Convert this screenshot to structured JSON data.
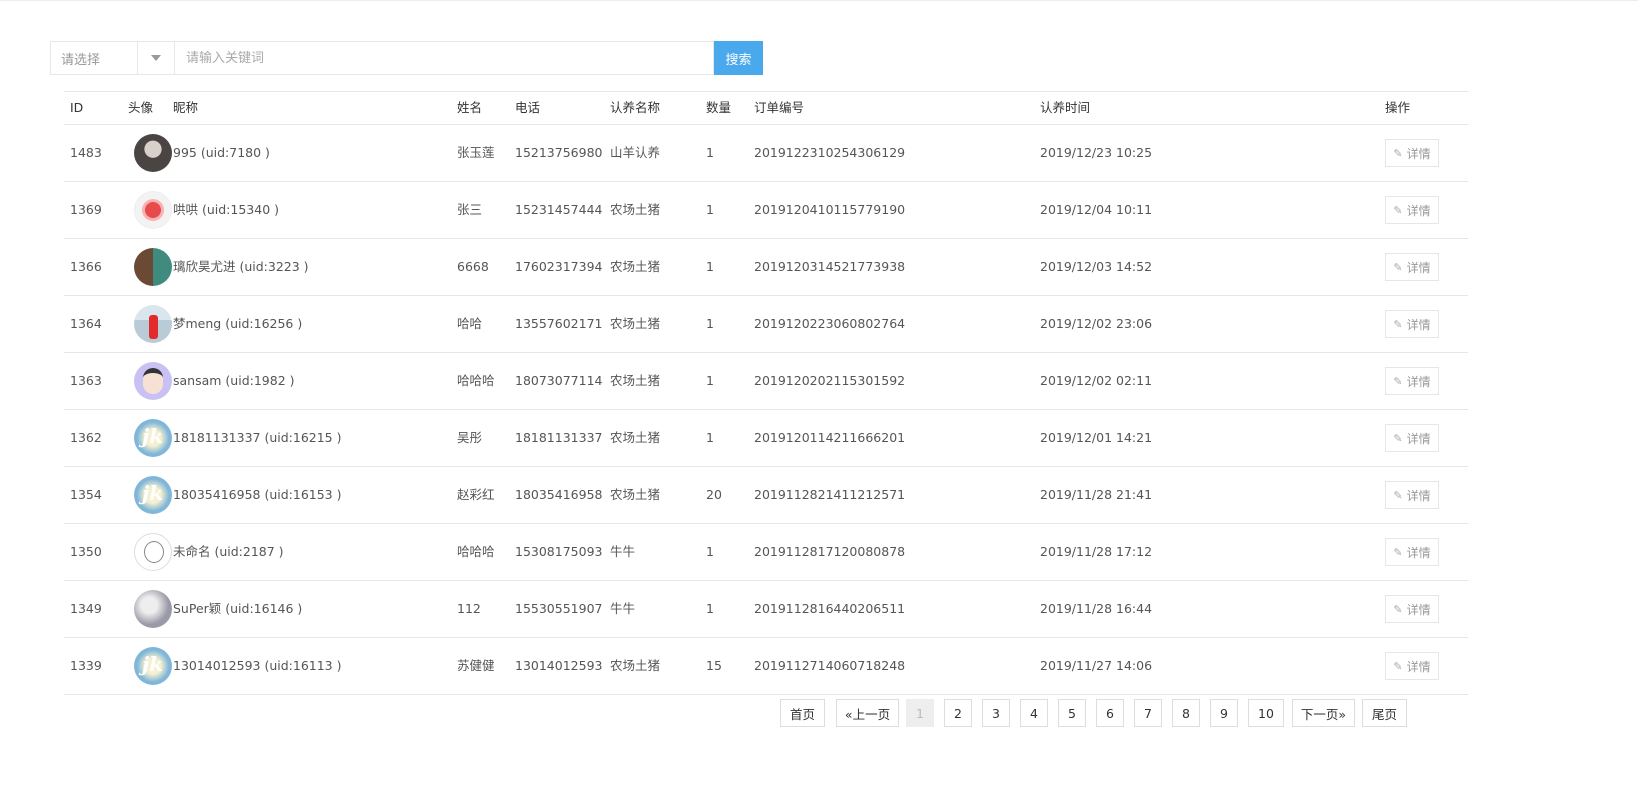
{
  "search": {
    "select_placeholder": "请选择",
    "input_placeholder": "请输入关键词",
    "button_label": "搜索"
  },
  "table": {
    "headers": {
      "id": "ID",
      "avatar": "头像",
      "nickname": "昵称",
      "name": "姓名",
      "phone": "电话",
      "adopt_name": "认养名称",
      "qty": "数量",
      "order_no": "订单编号",
      "adopt_time": "认养时间",
      "actions": "操作"
    },
    "detail_label": "详情",
    "rows": [
      {
        "id": "1483",
        "avatar": "dark",
        "nickname": "995 (uid:7180 )",
        "name": "张玉莲",
        "phone": "15213756980",
        "adopt_name": "山羊认养",
        "qty": "1",
        "order_no": "2019122310254306129",
        "adopt_time": "2019/12/23 10:25"
      },
      {
        "id": "1369",
        "avatar": "red",
        "nickname": "哄哄 (uid:15340 )",
        "name": "张三",
        "phone": "15231457444",
        "adopt_name": "农场土猪",
        "qty": "1",
        "order_no": "2019120410115779190",
        "adopt_time": "2019/12/04 10:11"
      },
      {
        "id": "1366",
        "avatar": "face",
        "nickname": "璃欣昊尤进 (uid:3223 )",
        "name": "6668",
        "phone": "17602317394",
        "adopt_name": "农场土猪",
        "qty": "1",
        "order_no": "2019120314521773938",
        "adopt_time": "2019/12/03 14:52"
      },
      {
        "id": "1364",
        "avatar": "girl",
        "nickname": "梦meng (uid:16256 )",
        "name": "哈哈",
        "phone": "13557602171",
        "adopt_name": "农场土猪",
        "qty": "1",
        "order_no": "2019120223060802764",
        "adopt_time": "2019/12/02 23:06"
      },
      {
        "id": "1363",
        "avatar": "cartoon",
        "nickname": "sansam (uid:1982 )",
        "name": "哈哈哈",
        "phone": "18073077114",
        "adopt_name": "农场土猪",
        "qty": "1",
        "order_no": "2019120202115301592",
        "adopt_time": "2019/12/02 02:11"
      },
      {
        "id": "1362",
        "avatar": "jk",
        "nickname": "18181131337 (uid:16215 )",
        "name": "吴彤",
        "phone": "18181131337",
        "adopt_name": "农场土猪",
        "qty": "1",
        "order_no": "2019120114211666201",
        "adopt_time": "2019/12/01 14:21"
      },
      {
        "id": "1354",
        "avatar": "jk",
        "nickname": "18035416958 (uid:16153 )",
        "name": "赵彩红",
        "phone": "18035416958",
        "adopt_name": "农场土猪",
        "qty": "20",
        "order_no": "2019112821411212571",
        "adopt_time": "2019/11/28 21:41"
      },
      {
        "id": "1350",
        "avatar": "sketch",
        "nickname": "未命名 (uid:2187 )",
        "name": "哈哈哈",
        "phone": "15308175093",
        "adopt_name": "牛牛",
        "qty": "1",
        "order_no": "2019112817120080878",
        "adopt_time": "2019/11/28 17:12"
      },
      {
        "id": "1349",
        "avatar": "gray",
        "nickname": "SuPer颖 (uid:16146 )",
        "name": "112",
        "phone": "15530551907",
        "adopt_name": "牛牛",
        "qty": "1",
        "order_no": "2019112816440206511",
        "adopt_time": "2019/11/28 16:44"
      },
      {
        "id": "1339",
        "avatar": "jk",
        "nickname": "13014012593 (uid:16113 )",
        "name": "苏健健",
        "phone": "13014012593",
        "adopt_name": "农场土猪",
        "qty": "15",
        "order_no": "2019112714060718248",
        "adopt_time": "2019/11/27 14:06"
      }
    ]
  },
  "pagination": {
    "first": "首页",
    "prev": "«上一页",
    "pages": [
      "1",
      "2",
      "3",
      "4",
      "5",
      "6",
      "7",
      "8",
      "9",
      "10"
    ],
    "current": "1",
    "next": "下一页»",
    "last": "尾页"
  }
}
